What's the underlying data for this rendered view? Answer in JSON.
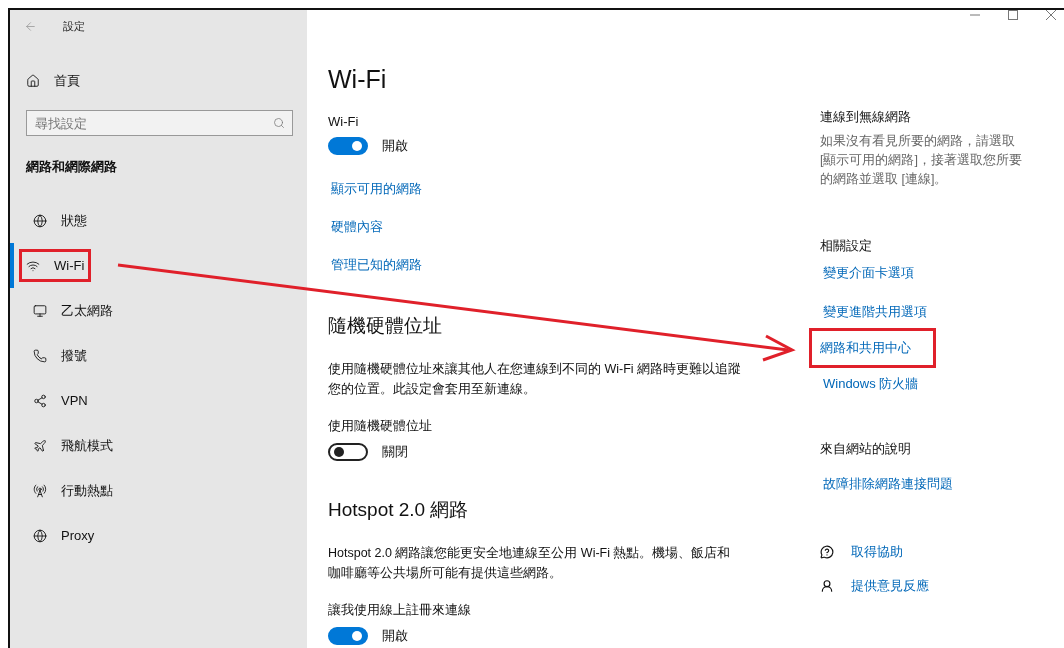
{
  "window": {
    "title": "設定"
  },
  "sidebar": {
    "home": "首頁",
    "search": {
      "placeholder": "尋找設定"
    },
    "heading": "網路和網際網路",
    "items": [
      {
        "label": "狀態",
        "selected": false,
        "highlighted": false
      },
      {
        "label": "Wi-Fi",
        "selected": true,
        "highlighted": true
      },
      {
        "label": "乙太網路",
        "selected": false,
        "highlighted": false
      },
      {
        "label": "撥號",
        "selected": false,
        "highlighted": false
      },
      {
        "label": "VPN",
        "selected": false,
        "highlighted": false
      },
      {
        "label": "飛航模式",
        "selected": false,
        "highlighted": false
      },
      {
        "label": "行動熱點",
        "selected": false,
        "highlighted": false
      },
      {
        "label": "Proxy",
        "selected": false,
        "highlighted": false
      }
    ]
  },
  "main": {
    "title": "Wi-Fi",
    "wifi": {
      "label": "Wi-Fi",
      "on": true,
      "state": "開啟"
    },
    "links": [
      "顯示可用的網路",
      "硬體內容",
      "管理已知的網路"
    ],
    "sections": [
      {
        "heading": "隨機硬體位址",
        "text": "使用隨機硬體位址來讓其他人在您連線到不同的 Wi-Fi 網路時更難以追蹤您的位置。此設定會套用至新連線。",
        "toggle_label": "使用隨機硬體位址",
        "on": false,
        "state": "關閉"
      },
      {
        "heading": "Hotspot 2.0 網路",
        "text": "Hotspot 2.0 網路讓您能更安全地連線至公用 Wi-Fi 熱點。機場、飯店和咖啡廳等公共場所可能有提供這些網路。",
        "toggle_label": "讓我使用線上註冊來連線",
        "on": true,
        "state": "開啟"
      }
    ]
  },
  "aside": {
    "connect": {
      "heading": "連線到無線網路",
      "text": "如果沒有看見所要的網路，請選取 [顯示可用的網路]，接著選取您所要的網路並選取 [連線]。"
    },
    "related": {
      "heading": "相關設定",
      "links": [
        {
          "label": "變更介面卡選項",
          "highlighted": false
        },
        {
          "label": "變更進階共用選項",
          "highlighted": false
        },
        {
          "label": "網路和共用中心",
          "highlighted": true
        },
        {
          "label": "Windows 防火牆",
          "highlighted": false
        }
      ]
    },
    "web_help": {
      "heading": "來自網站的說明",
      "links": [
        "故障排除網路連接問題"
      ]
    },
    "actions": [
      "取得協助",
      "提供意見反應"
    ]
  },
  "annotation_arrow": true
}
